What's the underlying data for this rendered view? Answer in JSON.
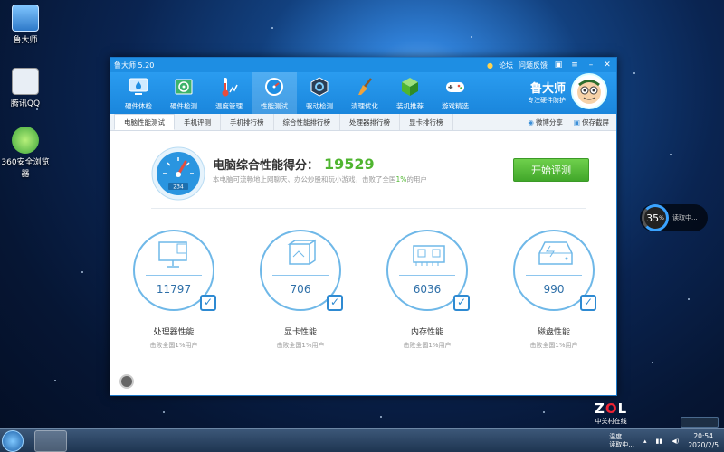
{
  "desktop": {
    "icons": [
      {
        "label": "鲁大师",
        "icon": "ludashi-app-icon"
      },
      {
        "label": "腾讯QQ",
        "icon": "qq-app-icon"
      },
      {
        "label": "360安全浏览器",
        "icon": "360-browser-icon"
      }
    ]
  },
  "window": {
    "title": "鲁大师 5.20",
    "links": {
      "forum": "论坛",
      "feedback": "问题反馈"
    },
    "brand": {
      "name": "鲁大师",
      "slogan": "专注硬件防护"
    },
    "toolbar": [
      {
        "label": "硬件体检",
        "icon": "hardware-checkup-icon"
      },
      {
        "label": "硬件检测",
        "icon": "hardware-detect-icon"
      },
      {
        "label": "温度管理",
        "icon": "temperature-icon"
      },
      {
        "label": "性能测试",
        "icon": "performance-gauge-icon",
        "active": true
      },
      {
        "label": "驱动检测",
        "icon": "driver-icon"
      },
      {
        "label": "清理优化",
        "icon": "broom-icon"
      },
      {
        "label": "装机推荐",
        "icon": "cube-icon"
      },
      {
        "label": "游戏精选",
        "icon": "gamepad-icon"
      }
    ],
    "tabs": [
      {
        "label": "电脑性能测试",
        "active": true
      },
      {
        "label": "手机评测"
      },
      {
        "label": "手机排行榜"
      },
      {
        "label": "综合性能排行榜"
      },
      {
        "label": "处理器排行榜"
      },
      {
        "label": "显卡排行榜"
      }
    ],
    "actions": {
      "share": "微博分享",
      "screenshot": "保存截屏"
    }
  },
  "score": {
    "title": "电脑综合性能得分：",
    "value": "19529",
    "desc_before": "本电脑可流畅地上网聊天、办公炒股和玩小游戏，击败了全国",
    "desc_pct": "1%",
    "desc_after": "的用户",
    "gauge_value": "234",
    "start_button": "开始评测"
  },
  "metrics": [
    {
      "label": "处理器性能",
      "value": "11797",
      "sub": "击败全国1%用户",
      "icon": "cpu-monitor-icon"
    },
    {
      "label": "显卡性能",
      "value": "706",
      "sub": "击败全国1%用户",
      "icon": "graphics-card-icon"
    },
    {
      "label": "内存性能",
      "value": "6036",
      "sub": "击败全国1%用户",
      "icon": "memory-chip-icon"
    },
    {
      "label": "磁盘性能",
      "value": "990",
      "sub": "击败全国1%用户",
      "icon": "disk-drive-icon"
    }
  ],
  "side_widget": {
    "percent": "35",
    "unit": "%",
    "text": "读取中..."
  },
  "watermark": {
    "logo_z": "Z",
    "logo_o": "O",
    "logo_l": "L",
    "cn": "中关村在线"
  },
  "taskbar": {
    "tray_line1": "温度",
    "tray_line2": "读取中...",
    "time": "20:54",
    "date": "2020/2/5"
  },
  "colors": {
    "accent": "#1e8ee3",
    "score_green": "#4fb530",
    "button_green": "#41a72a"
  }
}
